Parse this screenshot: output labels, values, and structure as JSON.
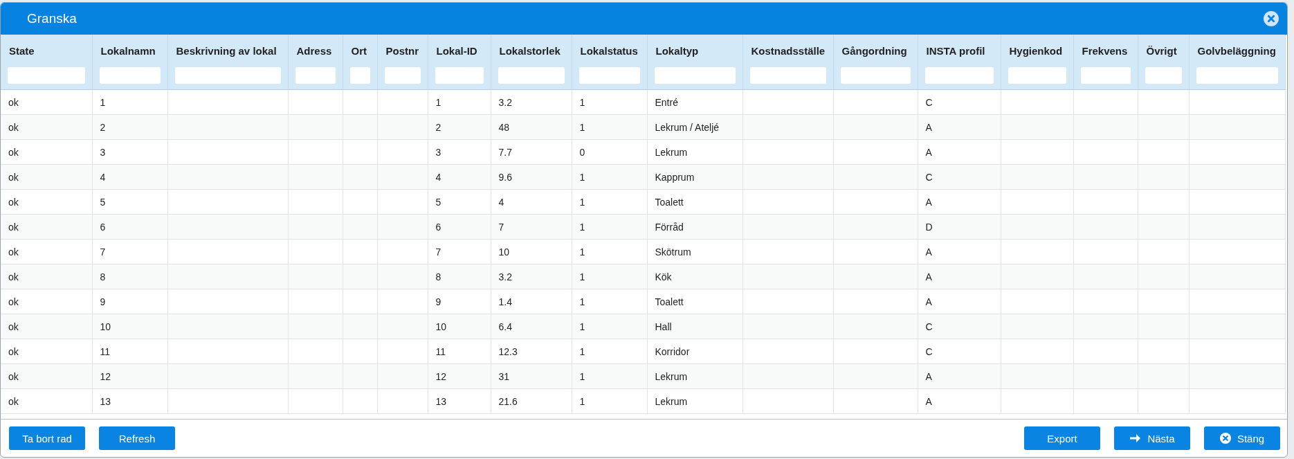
{
  "window": {
    "title": "Granska"
  },
  "table": {
    "columns": [
      "State",
      "Lokalnamn",
      "Beskrivning av lokal",
      "Adress",
      "Ort",
      "Postnr",
      "Lokal-ID",
      "Lokalstorlek",
      "Lokalstatus",
      "Lokaltyp",
      "Kostnadsställe",
      "Gångordning",
      "INSTA profil",
      "Hygienkod",
      "Frekvens",
      "Övrigt",
      "Golvbeläggning"
    ],
    "rows": [
      [
        "ok",
        "1",
        null,
        null,
        null,
        null,
        "1",
        "3.2",
        "1",
        "Entré",
        null,
        null,
        "C",
        null,
        null,
        null,
        null
      ],
      [
        "ok",
        "2",
        null,
        null,
        null,
        null,
        "2",
        "48",
        "1",
        "Lekrum / Ateljé",
        null,
        null,
        "A",
        null,
        null,
        null,
        null
      ],
      [
        "ok",
        "3",
        null,
        null,
        null,
        null,
        "3",
        "7.7",
        "0",
        "Lekrum",
        null,
        null,
        "A",
        null,
        null,
        null,
        null
      ],
      [
        "ok",
        "4",
        null,
        null,
        null,
        null,
        "4",
        "9.6",
        "1",
        "Kapprum",
        null,
        null,
        "C",
        null,
        null,
        null,
        null
      ],
      [
        "ok",
        "5",
        null,
        null,
        null,
        null,
        "5",
        "4",
        "1",
        "Toalett",
        null,
        null,
        "A",
        null,
        null,
        null,
        null
      ],
      [
        "ok",
        "6",
        null,
        null,
        null,
        null,
        "6",
        "7",
        "1",
        "Förråd",
        null,
        null,
        "D",
        null,
        null,
        null,
        null
      ],
      [
        "ok",
        "7",
        null,
        null,
        null,
        null,
        "7",
        "10",
        "1",
        "Skötrum",
        null,
        null,
        "A",
        null,
        null,
        null,
        null
      ],
      [
        "ok",
        "8",
        null,
        null,
        null,
        null,
        "8",
        "3.2",
        "1",
        "Kök",
        null,
        null,
        "A",
        null,
        null,
        null,
        null
      ],
      [
        "ok",
        "9",
        null,
        null,
        null,
        null,
        "9",
        "1.4",
        "1",
        "Toalett",
        null,
        null,
        "A",
        null,
        null,
        null,
        null
      ],
      [
        "ok",
        "10",
        null,
        null,
        null,
        null,
        "10",
        "6.4",
        "1",
        "Hall",
        null,
        null,
        "C",
        null,
        null,
        null,
        null
      ],
      [
        "ok",
        "11",
        null,
        null,
        null,
        null,
        "11",
        "12.3",
        "1",
        "Korridor",
        null,
        null,
        "C",
        null,
        null,
        null,
        null
      ],
      [
        "ok",
        "12",
        null,
        null,
        null,
        null,
        "12",
        "31",
        "1",
        "Lekrum",
        null,
        null,
        "A",
        null,
        null,
        null,
        null
      ],
      [
        "ok",
        "13",
        null,
        null,
        null,
        null,
        "13",
        "21.6",
        "1",
        "Lekrum",
        null,
        null,
        "A",
        null,
        null,
        null,
        null
      ]
    ]
  },
  "footer": {
    "left_buttons": [
      {
        "label": "Ta bort rad",
        "kind": "plain"
      },
      {
        "label": "Refresh",
        "kind": "plain"
      }
    ],
    "right_buttons": [
      {
        "label": "Export",
        "kind": "plain"
      },
      {
        "label": "Nästa",
        "kind": "next"
      },
      {
        "label": "Stäng",
        "kind": "close"
      }
    ]
  }
}
